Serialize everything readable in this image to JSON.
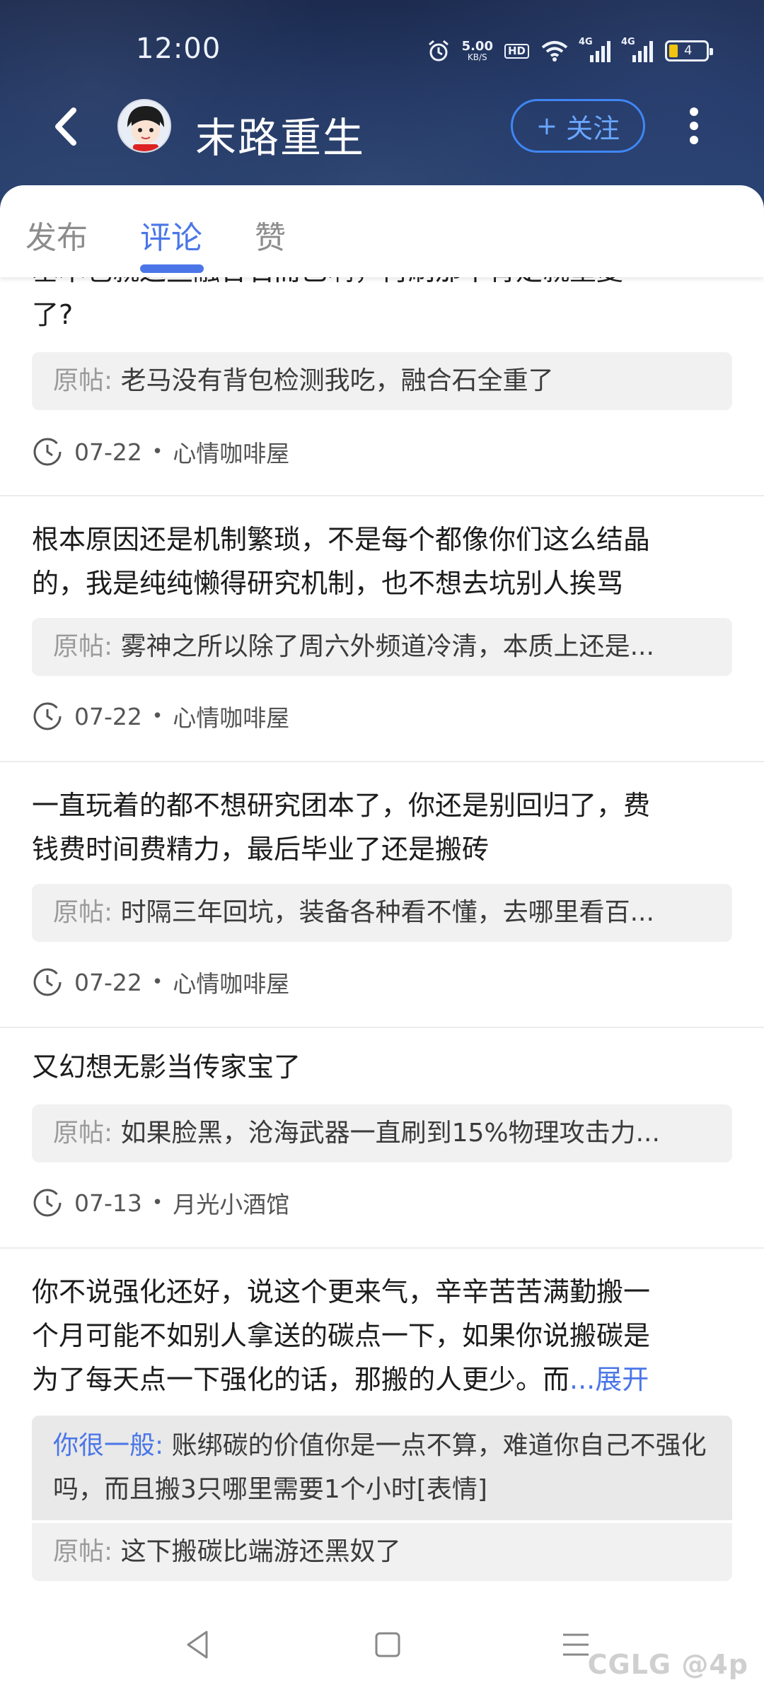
{
  "status_bar": {
    "time": "12:00",
    "net_speed_value": "5.00",
    "net_speed_unit": "KB/S",
    "hd_label": "HD",
    "sim1_label": "4G",
    "sim2_label": "4G",
    "battery_level": "4"
  },
  "header": {
    "name": "末路重生",
    "follow_plus": "+",
    "follow_label": "关注"
  },
  "tabs": [
    {
      "label": "发布",
      "active": false
    },
    {
      "label": "评论",
      "active": true
    },
    {
      "label": "赞",
      "active": false
    }
  ],
  "feed": {
    "items": [
      {
        "comment_line1": "基本也就这些融合石而已啊，再刷那不肯定就重复",
        "comment_line2": "了?",
        "quote_prefix": "原帖:",
        "quote_text": "老马没有背包检测我吃，融合石全重了",
        "date": "07-22",
        "channel": "心情咖啡屋"
      },
      {
        "comment_line1": "根本原因还是机制繁琐，不是每个都像你们这么结晶",
        "comment_line2": "的，我是纯纯懒得研究机制，也不想去坑别人挨骂",
        "quote_prefix": "原帖:",
        "quote_text": "雾神之所以除了周六外频道冷清，本质上还是...",
        "date": "07-22",
        "channel": "心情咖啡屋"
      },
      {
        "comment_line1": "一直玩着的都不想研究团本了，你还是别回归了，费",
        "comment_line2": "钱费时间费精力，最后毕业了还是搬砖",
        "quote_prefix": "原帖:",
        "quote_text": "时隔三年回坑，装备各种看不懂，去哪里看百...",
        "date": "07-22",
        "channel": "心情咖啡屋"
      },
      {
        "comment_line1": "又幻想无影当传家宝了",
        "quote_prefix": "原帖:",
        "quote_text": "如果脸黑，沧海武器一直刷到15%物理攻击力...",
        "date": "07-13",
        "channel": "月光小酒馆"
      },
      {
        "comment_line1": "你不说强化还好，说这个更来气，辛辛苦苦满勤搬一",
        "comment_line2": "个月可能不如别人拿送的碳点一下，如果你说搬碳是",
        "comment_line3": "为了每天点一下强化的话，那搬的人更少。而",
        "expand_label": "...展开",
        "reply_who": "你很一般:",
        "reply_text": " 账绑碳的价值你是一点不算，难道你自己不强化吗，而且搬3只哪里需要1个小时[表情]",
        "quote_prefix": "原帖:",
        "quote_text": "这下搬碳比端游还黑奴了"
      }
    ]
  },
  "watermark": "CGLG @4p",
  "colors": {
    "accent": "#4a76e8",
    "header_bg": "#203562",
    "follow_border": "#3f86f5"
  },
  "icons": {
    "back": "back-arrow-icon",
    "more": "more-vertical-icon",
    "clock": "clock-icon",
    "nav_back": "triangle-back-icon",
    "nav_home": "square-home-icon",
    "nav_menu": "menu-lines-icon"
  }
}
